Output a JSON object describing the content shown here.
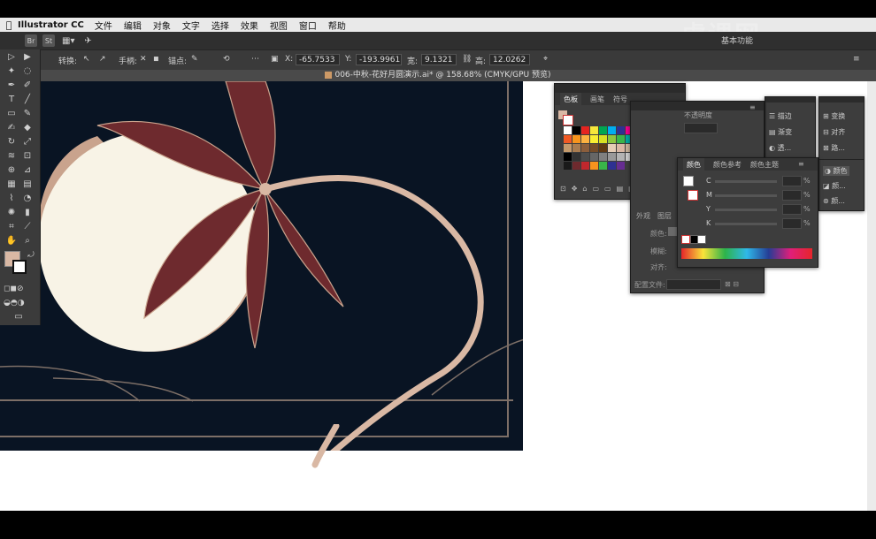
{
  "menubar": {
    "apple": "",
    "app_name": "Illustrator CC",
    "items": [
      "文件",
      "编辑",
      "对象",
      "文字",
      "选择",
      "效果",
      "视图",
      "窗口",
      "帮助"
    ]
  },
  "appbar": {
    "workspace_label": "基本功能"
  },
  "watermark": "虎课网",
  "control_bar": {
    "convert_label": "转换:",
    "handle_label": "手柄:",
    "anchor_label": "锚点:",
    "x_label": "X:",
    "x_value": "-65.7533",
    "y_label": "Y:",
    "y_value": "-193.9961",
    "w_label": "宽:",
    "w_value": "9.1321",
    "h_label": "高:",
    "h_value": "12.0262"
  },
  "document_tab": {
    "title": "006-中秋-花好月圆演示.ai* @ 158.68% (CMYK/GPU 预览)"
  },
  "swatches_panel": {
    "tabs": [
      "色板",
      "画笔",
      "符号"
    ]
  },
  "right_dock_1": {
    "items": [
      "描边",
      "渐变",
      "透..."
    ]
  },
  "right_dock_2": {
    "items": [
      "变换",
      "对齐",
      "路..."
    ],
    "items_b": [
      "颜色",
      "颜...",
      "颜..."
    ]
  },
  "color_panel": {
    "tabs": [
      "颜色",
      "颜色参考",
      "颜色主题"
    ],
    "channels": [
      "C",
      "M",
      "Y",
      "K"
    ],
    "percent": "%"
  },
  "transparency_panel": {
    "title": "不透明度",
    "tabs": [
      "外观",
      "图层"
    ],
    "labels": [
      "颜色:",
      "模糊:",
      "对齐:"
    ],
    "bottom_label": "配置文件:"
  },
  "colors": {
    "artboard_bg": "#091423",
    "moon": "#f8f3e6",
    "petal": "#6e2a2e",
    "stem": "#d9b8a4",
    "line": "#7d6f67"
  }
}
